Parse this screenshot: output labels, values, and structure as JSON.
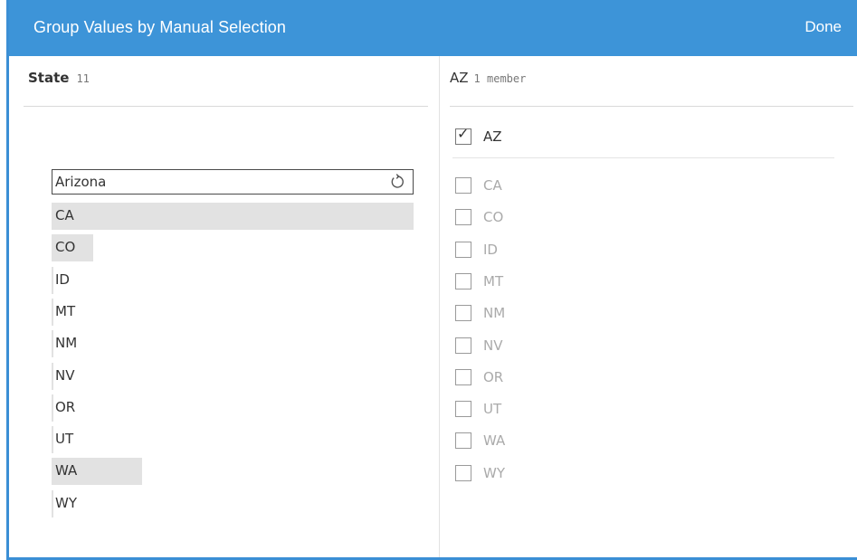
{
  "dialog": {
    "title": "Group Values by Manual Selection",
    "done_label": "Done"
  },
  "left_panel": {
    "field_name": "State",
    "field_count": "11",
    "edit_value": "Arizona",
    "reset_icon": "reset-icon",
    "values": [
      {
        "label": "CA",
        "bar_fraction": 1.0
      },
      {
        "label": "CO",
        "bar_fraction": 0.115
      },
      {
        "label": "ID",
        "bar_fraction": 0.0
      },
      {
        "label": "MT",
        "bar_fraction": 0.0
      },
      {
        "label": "NM",
        "bar_fraction": 0.0
      },
      {
        "label": "NV",
        "bar_fraction": 0.0
      },
      {
        "label": "OR",
        "bar_fraction": 0.0
      },
      {
        "label": "UT",
        "bar_fraction": 0.0
      },
      {
        "label": "WA",
        "bar_fraction": 0.25
      },
      {
        "label": "WY",
        "bar_fraction": 0.0
      }
    ]
  },
  "right_panel": {
    "group_name": "AZ",
    "member_count": "1 member",
    "checked_items": [
      {
        "label": "AZ",
        "checked": true
      }
    ],
    "unchecked_items": [
      {
        "label": "CA",
        "checked": false
      },
      {
        "label": "CO",
        "checked": false
      },
      {
        "label": "ID",
        "checked": false
      },
      {
        "label": "MT",
        "checked": false
      },
      {
        "label": "NM",
        "checked": false
      },
      {
        "label": "NV",
        "checked": false
      },
      {
        "label": "OR",
        "checked": false
      },
      {
        "label": "UT",
        "checked": false
      },
      {
        "label": "WA",
        "checked": false
      },
      {
        "label": "WY",
        "checked": false
      }
    ]
  },
  "colors": {
    "header_bg": "#3d94d8",
    "header_text": "#ffffff",
    "bar_fill": "#e2e2e2",
    "unchecked_text": "#aaaaaa"
  }
}
